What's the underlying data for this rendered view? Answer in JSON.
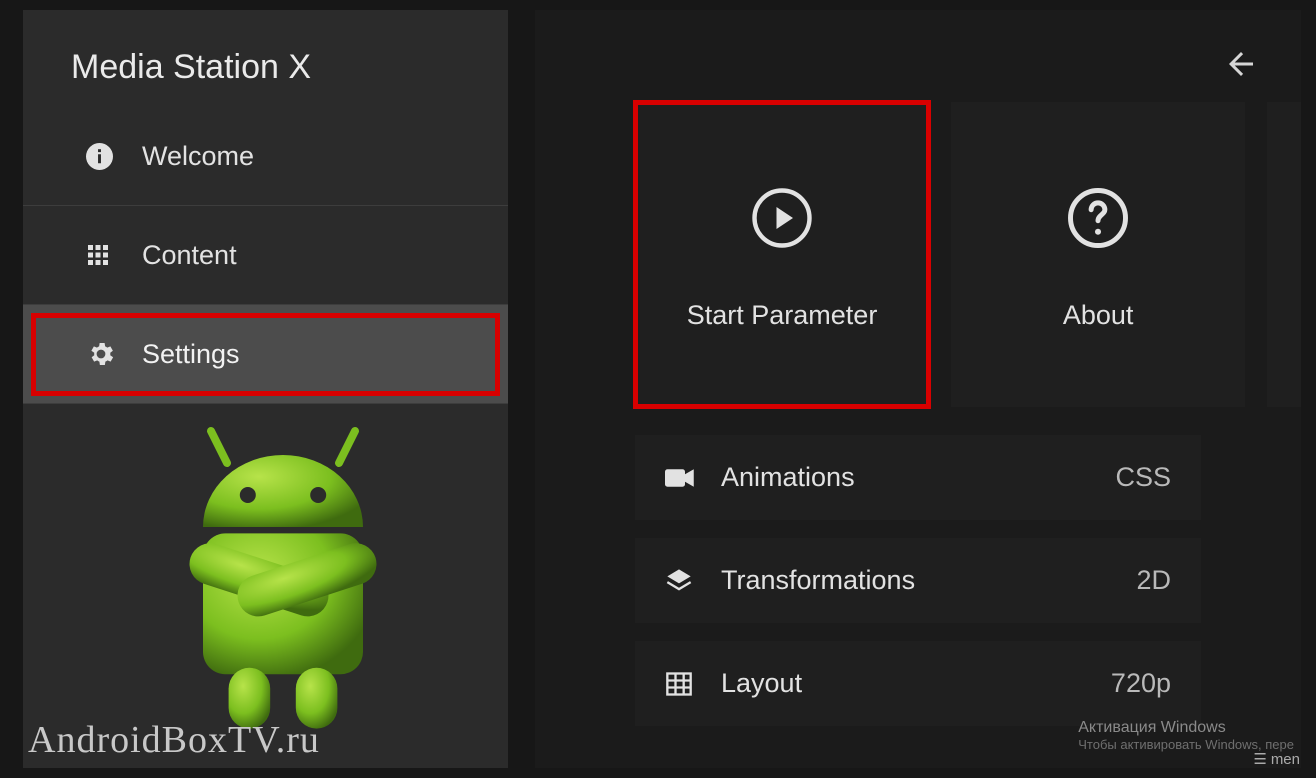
{
  "sidebar": {
    "title": "Media Station X",
    "items": [
      {
        "label": "Welcome"
      },
      {
        "label": "Content"
      },
      {
        "label": "Settings"
      }
    ]
  },
  "tiles": {
    "start_parameter": "Start Parameter",
    "about": "About"
  },
  "rows": [
    {
      "label": "Animations",
      "value": "CSS"
    },
    {
      "label": "Transformations",
      "value": "2D"
    },
    {
      "label": "Layout",
      "value": "720p"
    }
  ],
  "watermark": "AndroidBoxTV.ru",
  "activation": {
    "line1": "Активация Windows",
    "line2": "Чтобы активировать Windows, пере"
  },
  "menu_hint": "men"
}
